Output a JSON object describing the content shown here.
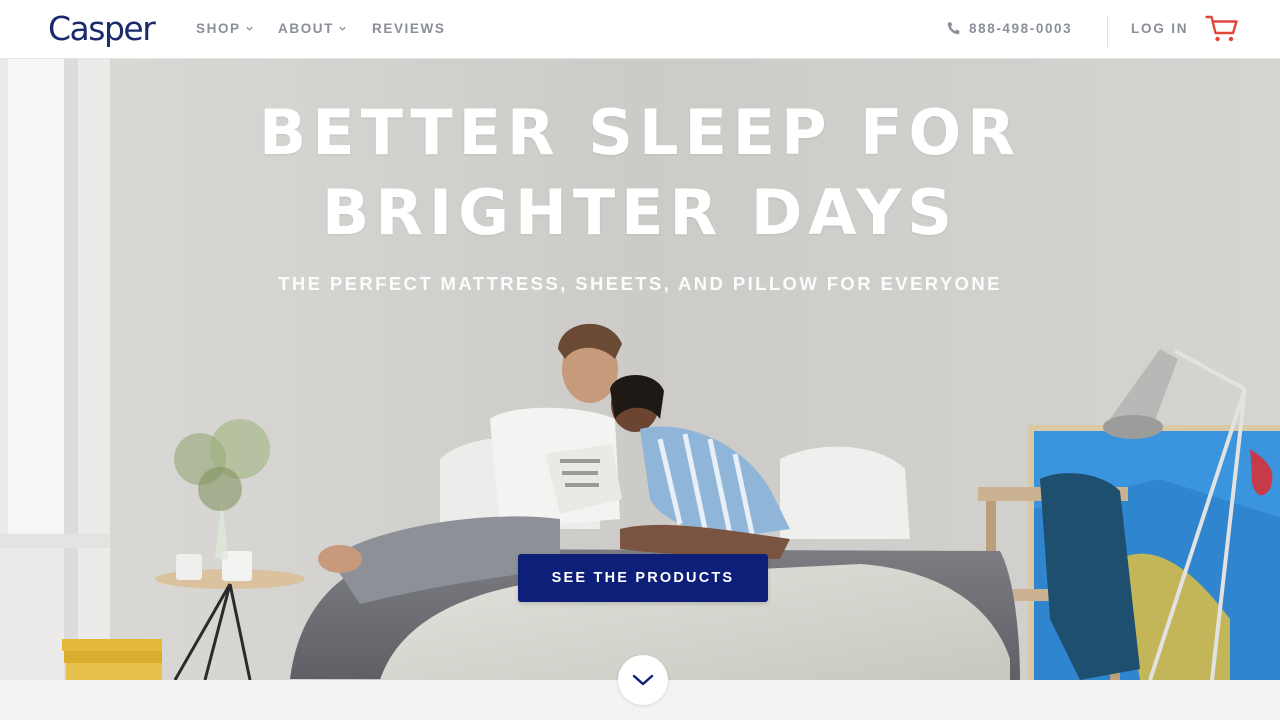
{
  "nav": {
    "logo": "Casper",
    "links": [
      {
        "label": "SHOP",
        "has_dropdown": true
      },
      {
        "label": "ABOUT",
        "has_dropdown": true
      },
      {
        "label": "REVIEWS",
        "has_dropdown": false
      }
    ],
    "phone": "888-498-0003",
    "login": "LOG IN",
    "cart_icon": "cart-icon"
  },
  "hero": {
    "headline_line1": "BETTER SLEEP FOR",
    "headline_line2": "BRIGHTER DAYS",
    "subheadline": "THE PERFECT MATTRESS, SHEETS, AND PILLOW FOR EVERYONE",
    "cta_label": "SEE THE PRODUCTS",
    "scroll_icon": "chevron-down-icon"
  },
  "colors": {
    "brand_navy": "#1b2a6b",
    "cta_blue": "#0e1f7a",
    "nav_text": "#8b8f99",
    "cart_red": "#e0463a"
  }
}
